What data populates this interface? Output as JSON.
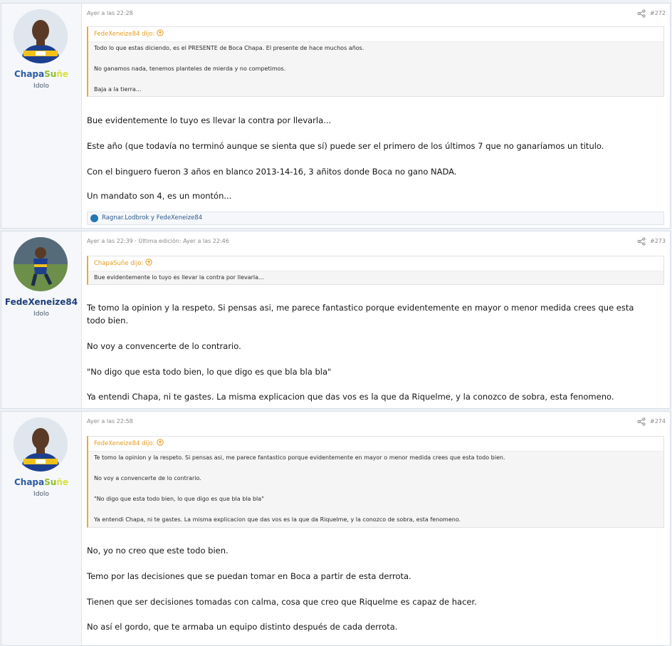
{
  "posts": [
    {
      "author": {
        "name_part1": "Chapa",
        "name_part2": "Su",
        "name_part3": "ñe",
        "title": "Idolo"
      },
      "meta": "Ayer a las 22:28",
      "number": "#272",
      "quote": {
        "header": "FedeXeneize84 dijo:",
        "lines": [
          "Todo lo que estas diciendo, es el PRESENTE de Boca Chapa. El presente de hace muchos años.",
          "No ganamos nada, tenemos planteles de mierda y no competimos.",
          "Baja a la tierra..."
        ]
      },
      "body": [
        "Bue evidentemente lo tuyo es llevar la contra por llevarla...",
        "Este año (que todavía no terminó aunque se sienta que sí) puede ser el primero de los últimos 7 que no ganaríamos un titulo.",
        "Con el binguero fueron 3 años en blanco 2013-14-16, 3 añitos donde Boca no gano NADA.",
        "Un mandato son 4, es un montón..."
      ],
      "reactions": "Ragnar.Lodbrok y FedeXeneize84"
    },
    {
      "author": {
        "name": "FedeXeneize84",
        "title": "Idolo"
      },
      "meta": "Ayer a las 22:39 · Última edición: Ayer a las 22:46",
      "number": "#273",
      "quote": {
        "header": "ChapaSuñe dijo:",
        "lines": [
          "Bue evidentemente lo tuyo es llevar la contra por llevarla..."
        ]
      },
      "body": [
        "Te tomo la opinion y la respeto. Si pensas asi, me parece fantastico porque evidentemente en mayor o menor medida crees que esta",
        "todo bien.",
        "No voy a convencerte de lo contrario.",
        "\"No digo que esta todo bien, lo que digo es que bla bla bla\"",
        "Ya entendi Chapa, ni te gastes. La misma explicacion que das vos es la que da Riquelme, y la conozco de sobra, esta fenomeno."
      ]
    },
    {
      "author": {
        "name_part1": "Chapa",
        "name_part2": "Su",
        "name_part3": "ñe",
        "title": "Idolo"
      },
      "meta": "Ayer a las 22:58",
      "number": "#274",
      "quote": {
        "header": "FedeXeneize84 dijo:",
        "lines": [
          "Te tomo la opinion y la respeto. Si pensas asi, me parece fantastico porque evidentemente en mayor o menor medida crees que esta todo bien.",
          "No voy a convencerte de lo contrario.",
          "\"No digo que esta todo bien, lo que digo es que bla bla bla\"",
          "Ya entendi Chapa, ni te gastes. La misma explicacion que das vos es la que da Riquelme, y la conozco de sobra, esta fenomeno."
        ]
      },
      "body": [
        "No, yo no creo que este todo bien.",
        "Temo por las decisiones que se puedan tomar en Boca a partir de esta derrota.",
        "Tienen que ser decisiones tomadas con calma, cosa que creo que Riquelme es capaz de hacer.",
        "No así el gordo, que te armaba un equipo distinto después de cada derrota."
      ]
    }
  ],
  "colors": {
    "quote_accent": "#f0a92b",
    "name_blue": "#2c5ca3",
    "name_green": "#8fbf2e",
    "name_yellow": "#d7e33a"
  }
}
